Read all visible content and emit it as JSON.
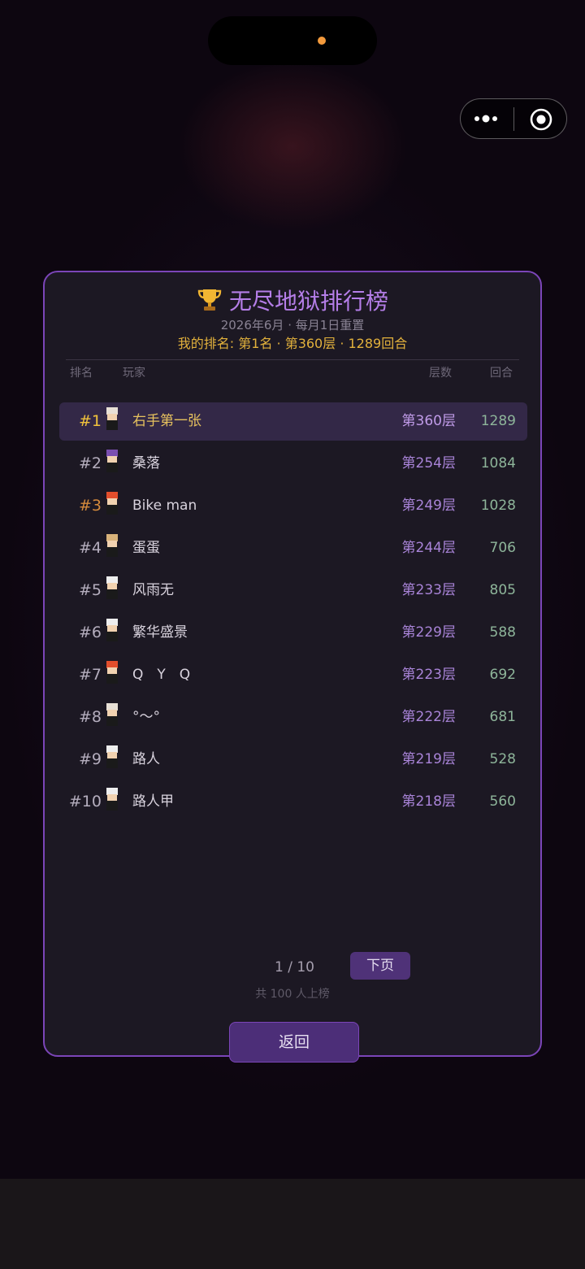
{
  "capsule": {
    "more_icon": "more-dots-icon",
    "close_icon": "target-circle-icon"
  },
  "leaderboard": {
    "title": "无尽地狱排行榜",
    "title_icon": "trophy-icon",
    "subtitle": "2026年6月 · 每月1日重置",
    "my_rank": "我的排名: 第1名 · 第360层 · 1289回合",
    "columns": {
      "rank": "排名",
      "player": "玩家",
      "floor": "层数",
      "rounds": "回合"
    },
    "rows": [
      {
        "rank": "#1",
        "name": "右手第一张",
        "floor": "第360层",
        "rounds": "1289",
        "rank_color": "#f0c23c",
        "highlight": true
      },
      {
        "rank": "#2",
        "name": "桑落",
        "floor": "第254层",
        "rounds": "1084",
        "rank_color": "#b4adbd"
      },
      {
        "rank": "#3",
        "name": "Bike man",
        "floor": "第249层",
        "rounds": "1028",
        "rank_color": "#d48a3c"
      },
      {
        "rank": "#4",
        "name": "蛋蛋",
        "floor": "第244层",
        "rounds": "706",
        "rank_color": "#b4adbd"
      },
      {
        "rank": "#5",
        "name": "风雨无",
        "floor": "第233层",
        "rounds": "805",
        "rank_color": "#b4adbd"
      },
      {
        "rank": "#6",
        "name": "繁华盛景",
        "floor": "第229层",
        "rounds": "588",
        "rank_color": "#b4adbd"
      },
      {
        "rank": "#7",
        "name": "Q　Y　Q",
        "floor": "第223层",
        "rounds": "692",
        "rank_color": "#b4adbd"
      },
      {
        "rank": "#8",
        "name": "°～°",
        "floor": "第222层",
        "rounds": "681",
        "rank_color": "#b4adbd"
      },
      {
        "rank": "#9",
        "name": "路人",
        "floor": "第219层",
        "rounds": "528",
        "rank_color": "#b4adbd"
      },
      {
        "rank": "#10",
        "name": "路人甲",
        "floor": "第218层",
        "rounds": "560",
        "rank_color": "#b4adbd"
      }
    ],
    "pagination": {
      "page": "1 / 10",
      "next_label": "下页",
      "total": "共 100 人上榜"
    },
    "back_label": "返回"
  },
  "colors": {
    "accent": "#7b45b8",
    "gold": "#e2b13c",
    "floor": "#a984d8",
    "rounds": "#8eb59a"
  }
}
